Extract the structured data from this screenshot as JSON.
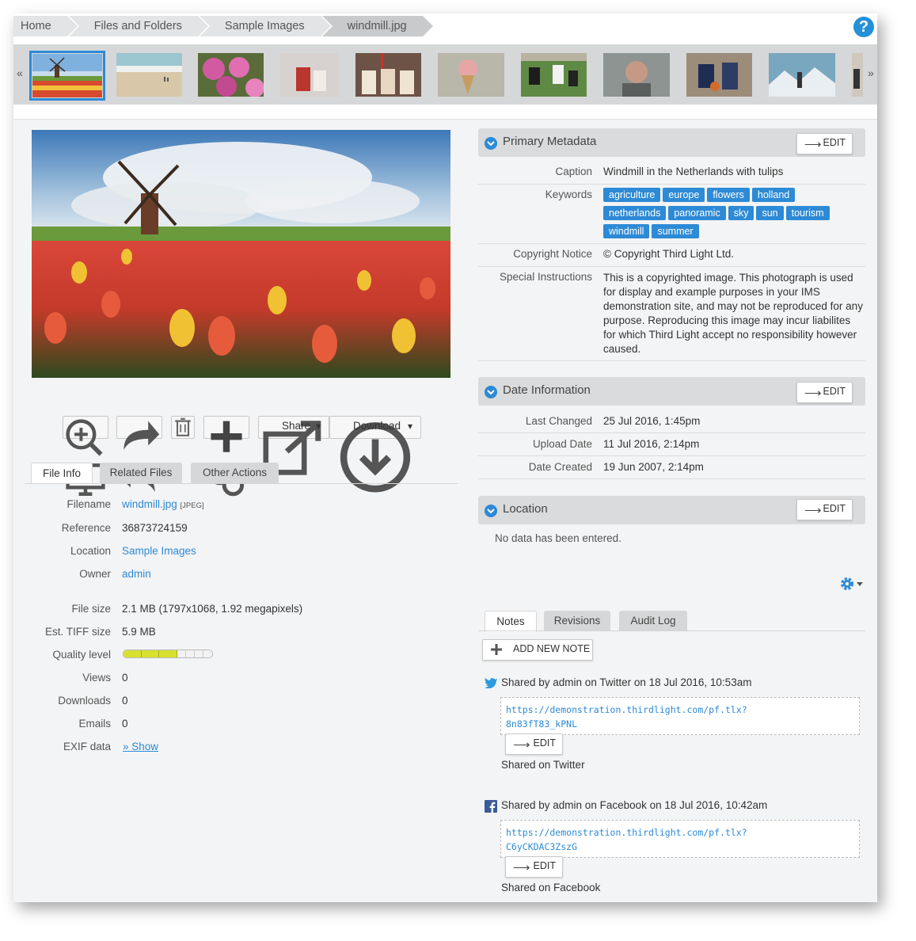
{
  "breadcrumb": [
    "Home",
    "Files and Folders",
    "Sample Images",
    "windmill.jpg"
  ],
  "help_label": "?",
  "strip": {
    "prev": "«",
    "next": "»"
  },
  "toolbar": {
    "share": "Share",
    "download": "Download",
    "caret": "▾"
  },
  "left_tabs": [
    "File Info",
    "Related Files",
    "Other Actions"
  ],
  "file_info": {
    "filename_label": "Filename",
    "filename": "windmill.jpg",
    "filetype": "[JPEG]",
    "reference_label": "Reference",
    "reference": "36873724159",
    "location_label": "Location",
    "location": "Sample Images",
    "owner_label": "Owner",
    "owner": "admin",
    "filesize_label": "File size",
    "filesize": "2.1 MB (1797x1068, 1.92 megapixels)",
    "tiff_label": "Est. TIFF size",
    "tiff": "5.9 MB",
    "quality_label": "Quality level",
    "quality_level": 0.6,
    "views_label": "Views",
    "views": "0",
    "downloads_label": "Downloads",
    "downloads": "0",
    "emails_label": "Emails",
    "emails": "0",
    "exif_label": "EXIF data",
    "exif": "» Show"
  },
  "primary_metadata": {
    "title": "Primary Metadata",
    "edit": "EDIT",
    "caption_label": "Caption",
    "caption": "Windmill in the Netherlands with tulips",
    "keywords_label": "Keywords",
    "keywords": [
      "agriculture",
      "europe",
      "flowers",
      "holland",
      "netherlands",
      "panoramic",
      "sky",
      "sun",
      "tourism",
      "windmill",
      "summer"
    ],
    "copyright_label": "Copyright Notice",
    "copyright": "© Copyright Third Light Ltd.",
    "special_label": "Special Instructions",
    "special": "This is a copyrighted image. This photograph is used for display and example purposes in your IMS demonstration site, and may not be reproduced for any purpose. Reproducing this image may incur liabilites for which Third Light accept no responsibility however caused."
  },
  "date_info": {
    "title": "Date Information",
    "edit": "EDIT",
    "changed_label": "Last Changed",
    "changed": "25 Jul 2016, 1:45pm",
    "upload_label": "Upload Date",
    "upload": "11 Jul 2016, 2:14pm",
    "created_label": "Date Created",
    "created": "19 Jun 2007, 2:14pm"
  },
  "location_panel": {
    "title": "Location",
    "edit": "EDIT",
    "empty": "No data has been entered."
  },
  "right_tabs": [
    "Notes",
    "Revisions",
    "Audit Log"
  ],
  "notes": {
    "add": "ADD NEW NOTE",
    "items": [
      {
        "header": "Shared by admin on Twitter on 18 Jul 2016, 10:53am",
        "link1": "https://demonstration.thirdlight.com/pf.tlx?",
        "link2": "8n83fT83_kPNL",
        "edit": "EDIT",
        "footer": "Shared on Twitter"
      },
      {
        "header": "Shared by admin on Facebook on 18 Jul 2016, 10:42am",
        "link1": "https://demonstration.thirdlight.com/pf.tlx?",
        "link2": "C6yCKDAC3ZszG",
        "edit": "EDIT",
        "footer": "Shared on Facebook"
      }
    ]
  },
  "colors": {
    "accent": "#2d8ad6",
    "panel_header": "#dadbdc",
    "background": "#f3f4f5"
  }
}
